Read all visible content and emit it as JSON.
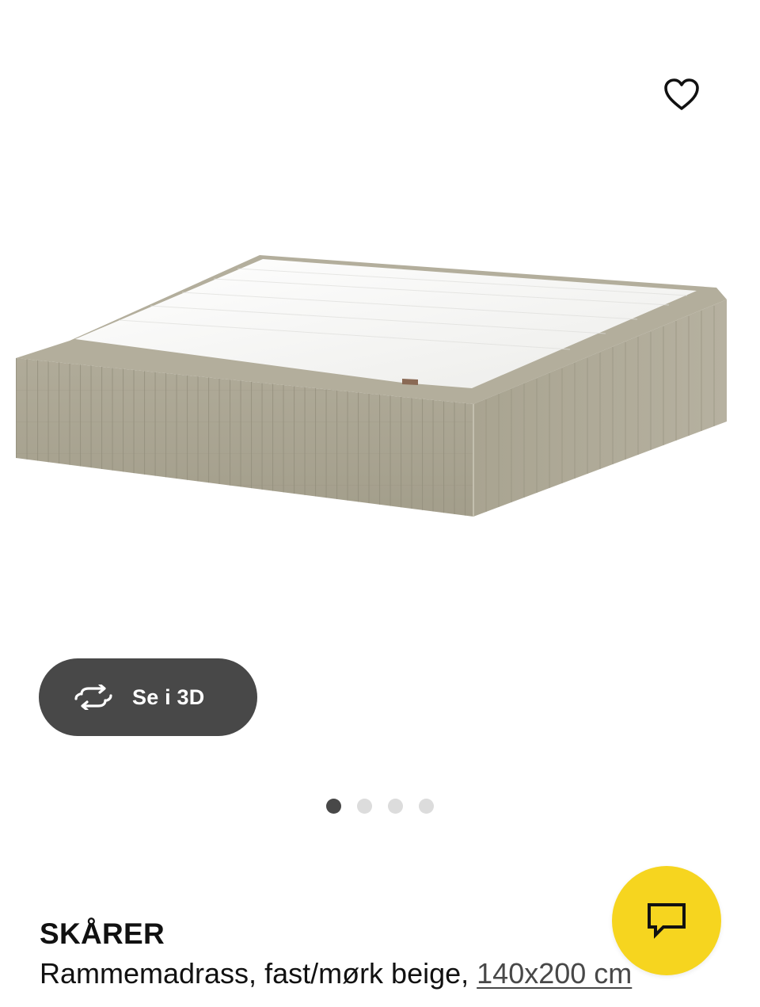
{
  "gallery": {
    "image_alt": "SKÅRER Rammemadrass, fast/mørk beige",
    "favorite_icon": "heart-outline-icon",
    "view3d": {
      "icon": "rotate-3d-icon",
      "label": "Se i 3D"
    },
    "pagination": {
      "total": 4,
      "active_index": 0
    }
  },
  "product": {
    "name": "SKÅRER",
    "description": "Rammemadrass, fast/mørk beige, ",
    "size_link": "140x200 cm"
  },
  "chat": {
    "icon": "chat-bubble-icon"
  },
  "colors": {
    "accent_yellow": "#f6d51f",
    "button_dark": "#484848",
    "mattress_beige": "#aaa593",
    "mattress_top": "#f3f3f1"
  }
}
